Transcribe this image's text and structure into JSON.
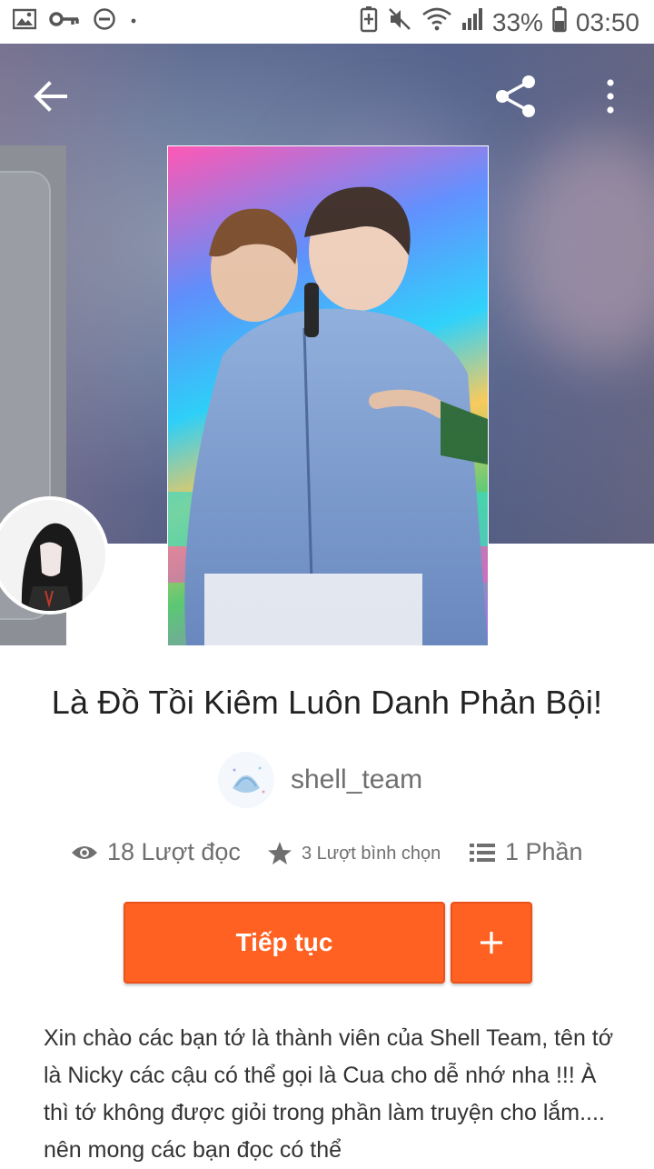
{
  "status_bar": {
    "battery_percent": "33%",
    "time": "03:50",
    "icons": [
      "image-icon",
      "key-icon",
      "do-not-disturb-icon",
      "dot-icon",
      "battery-saver-icon",
      "mute-icon",
      "wifi-icon",
      "signal-icon",
      "battery-icon"
    ]
  },
  "toolbar": {
    "icons": [
      "back-arrow-icon",
      "share-icon",
      "more-vertical-icon"
    ]
  },
  "story": {
    "title": "Là Đồ Tồi Kiêm Luôn Danh Phản Bội!",
    "author": "shell_team",
    "stats": {
      "reads": "18 Lượt đọc",
      "votes": "3 Lượt bình chọn",
      "parts": "1 Phần"
    },
    "continue_label": "Tiếp tục",
    "add_label": "+",
    "description": "Xin chào các bạn tớ là thành viên của Shell Team, tên tớ là Nicky các cậu có thể gọi là Cua cho dễ nhớ nha !!! À thì tớ không được giỏi trong phần làm truyện cho lắm.... nên mong các bạn đọc có thể"
  },
  "colors": {
    "accent": "#ff6122",
    "text_primary": "#222222",
    "text_secondary": "#6f6f6f"
  }
}
